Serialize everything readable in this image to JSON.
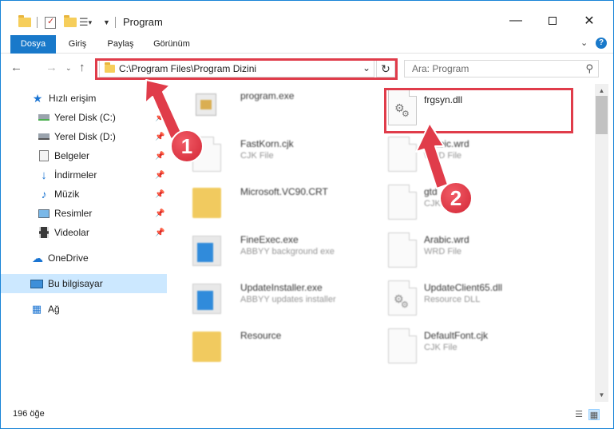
{
  "window": {
    "title": "Program",
    "minimize_icon": "minimize-icon",
    "maximize_icon": "maximize-icon",
    "close_icon": "close-icon"
  },
  "ribbon": {
    "tabs": [
      {
        "label": "Dosya",
        "active": true
      },
      {
        "label": "Giriş",
        "active": false
      },
      {
        "label": "Paylaş",
        "active": false
      },
      {
        "label": "Görünüm",
        "active": false
      }
    ]
  },
  "address_bar": {
    "path": "C:\\Program Files\\Program Dizini"
  },
  "search": {
    "placeholder": "Ara: Program"
  },
  "nav_pane": {
    "items": [
      {
        "label": "Hızlı erişim",
        "icon": "star-icon",
        "pinned": false,
        "selected": false
      },
      {
        "label": "Yerel Disk (C:)",
        "icon": "drive-icon",
        "pinned": true,
        "selected": false
      },
      {
        "label": "Yerel Disk (D:)",
        "icon": "drive-icon",
        "pinned": true,
        "selected": false
      },
      {
        "label": "Belgeler",
        "icon": "documents-icon",
        "pinned": true,
        "selected": false
      },
      {
        "label": "İndirmeler",
        "icon": "downloads-icon",
        "pinned": true,
        "selected": false
      },
      {
        "label": "Müzik",
        "icon": "music-icon",
        "pinned": true,
        "selected": false
      },
      {
        "label": "Resimler",
        "icon": "pictures-icon",
        "pinned": true,
        "selected": false
      },
      {
        "label": "Videolar",
        "icon": "videos-icon",
        "pinned": true,
        "selected": false
      },
      {
        "label": "OneDrive",
        "icon": "cloud-icon",
        "pinned": false,
        "selected": false
      },
      {
        "label": "Bu bilgisayar",
        "icon": "computer-icon",
        "pinned": false,
        "selected": true
      },
      {
        "label": "Ağ",
        "icon": "network-icon",
        "pinned": false,
        "selected": false
      }
    ]
  },
  "files": [
    {
      "name": "program.exe",
      "type": "",
      "icon": "program-exe-icon"
    },
    {
      "name": "frgsyn.dll",
      "type": "",
      "icon": "dll-gear-icon"
    },
    {
      "name": "FastKorn.cjk",
      "type": "CJK File",
      "icon": "document-icon"
    },
    {
      "name": "Arabic.wrd",
      "type": "WRD File",
      "icon": "document-icon"
    },
    {
      "name": "Microsoft.VC90.CRT",
      "type": "",
      "icon": "folder-icon"
    },
    {
      "name": "gtd",
      "type": "CJK",
      "icon": "document-icon"
    },
    {
      "name": "FineExec.exe",
      "type": "ABBYY background exe",
      "icon": "exe-icon"
    },
    {
      "name": "Arabic.wrd",
      "type": "WRD File",
      "icon": "document-icon"
    },
    {
      "name": "UpdateInstaller.exe",
      "type": "ABBYY updates installer",
      "icon": "exe-icon"
    },
    {
      "name": "UpdateClient65.dll",
      "type": "Resource DLL",
      "icon": "dll-gear-icon"
    },
    {
      "name": "Resource",
      "type": "",
      "icon": "folder-icon"
    },
    {
      "name": "DefaultFont.cjk",
      "type": "CJK File",
      "icon": "document-icon"
    }
  ],
  "status": {
    "item_count": "196 öğe"
  },
  "annotations": {
    "step1": "1",
    "step2": "2",
    "highlight_color": "#e03c4a"
  }
}
